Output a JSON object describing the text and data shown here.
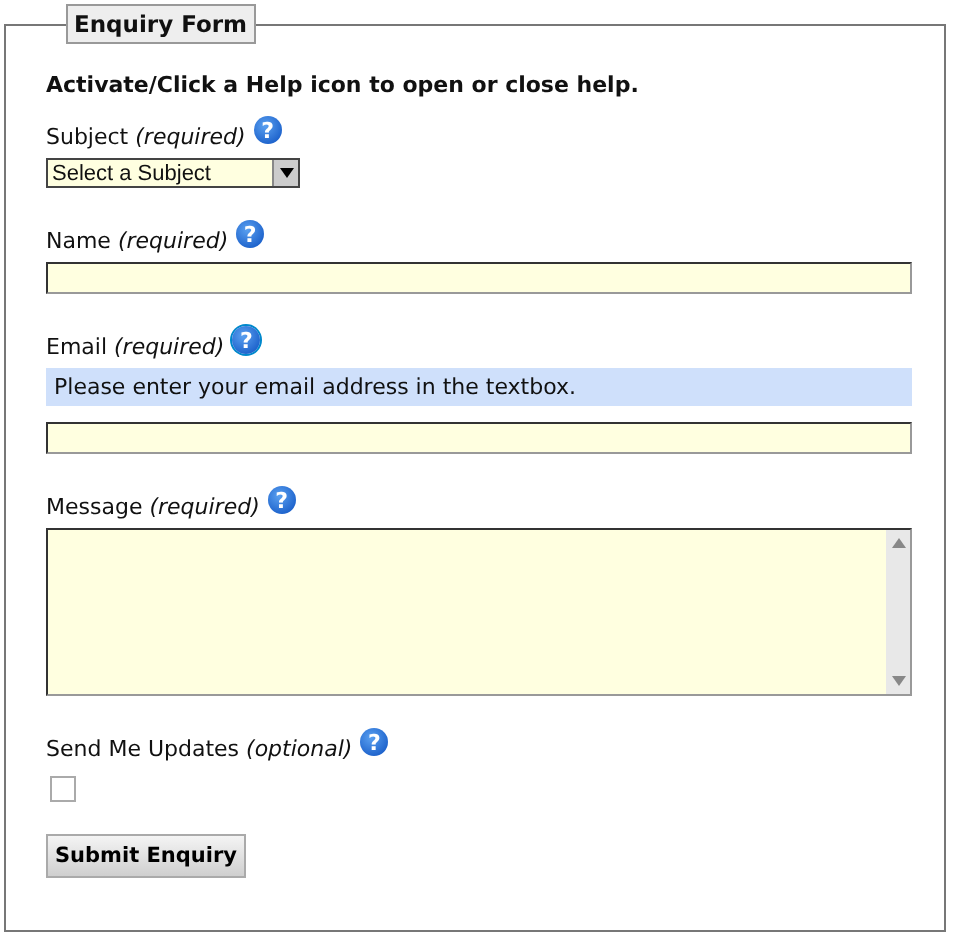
{
  "legend": "Enquiry Form",
  "instructions": "Activate/Click a Help icon to open or close help.",
  "fields": [
    {
      "kind": "select",
      "label": "Subject *(required)*",
      "help_icon": "?",
      "help_open": false,
      "value": "Select a Subject"
    },
    {
      "kind": "text",
      "label": "Name *(required)*",
      "help_icon": "?",
      "help_open": false
    },
    {
      "kind": "text",
      "label": "Email *(required)*",
      "help_icon": "?",
      "help_open": true,
      "help": "Please enter your email address in the textbox."
    },
    {
      "kind": "textarea",
      "label": "Message *(required)*",
      "help_icon": "?",
      "help_open": false
    },
    {
      "kind": "checkbox",
      "label": "Send Me Updates *(optional)*",
      "help_icon": "?",
      "help_open": false,
      "checked": false
    }
  ],
  "submit": "Submit Enquiry"
}
